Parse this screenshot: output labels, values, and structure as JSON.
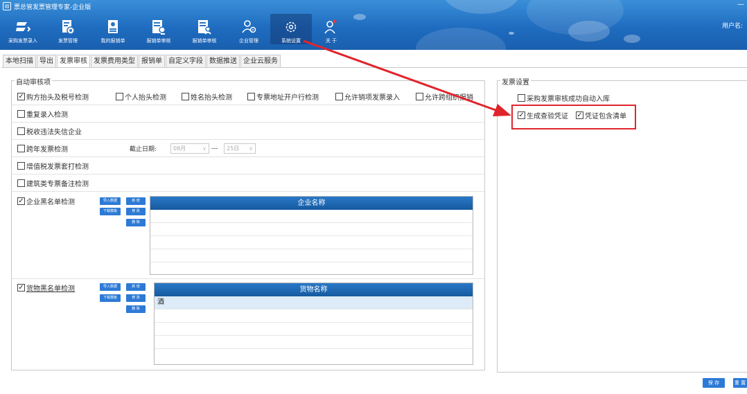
{
  "window": {
    "title": "票总管发票管理专家-企业版",
    "minimize_glyph": "—"
  },
  "toolbar": [
    {
      "label": "采购发票录入",
      "icon": "invoice-entry-icon"
    },
    {
      "label": "发票管理",
      "icon": "invoice-manage-icon"
    },
    {
      "label": "我的报销单",
      "icon": "my-reimburse-icon"
    },
    {
      "label": "报销单审核",
      "icon": "reimburse-review-icon"
    },
    {
      "label": "报销单审核",
      "icon": "reimburse-review-icon"
    },
    {
      "label": "企业管理",
      "icon": "enterprise-icon"
    },
    {
      "label": "系统设置",
      "icon": "gear-icon",
      "active": true
    },
    {
      "label": "关 于",
      "icon": "about-icon"
    }
  ],
  "user_label": "用户名:",
  "tabs": [
    "本地扫描",
    "导出",
    "发票审核",
    "发票费用类型",
    "报销单",
    "自定义字段",
    "数据推送",
    "企业云服务"
  ],
  "active_tab": "发票审核",
  "auto_review": {
    "legend": "自动审核项",
    "row1": [
      {
        "label": "购方抬头及税号检测",
        "checked": true
      },
      {
        "label": "个人抬头检测",
        "checked": false
      },
      {
        "label": "姓名抬头检测",
        "checked": false
      },
      {
        "label": "专票地址开户行检测",
        "checked": false
      },
      {
        "label": "允许销项发票录入",
        "checked": false
      },
      {
        "label": "允许跨组织报销",
        "checked": false
      }
    ],
    "dup_entry": {
      "label": "重复录入检测",
      "checked": false
    },
    "tax_violation": {
      "label": "税收违法失信企业",
      "checked": false
    },
    "cross_year": {
      "label": "跨年发票检测",
      "checked": false
    },
    "deadline_label": "截止日期:",
    "deadline_month": "08月",
    "deadline_sep": "---",
    "deadline_day": "25日",
    "vat_overprint": {
      "label": "增值税发票套打检测",
      "checked": false
    },
    "construction_note": {
      "label": "建筑类专票备注检测",
      "checked": false
    },
    "company_blacklist": {
      "label": "企业黑名单检测",
      "checked": true,
      "buttons": {
        "import": "导入数据",
        "template": "下载模板",
        "add": "新 增",
        "edit": "修 改",
        "delete": "删 除"
      },
      "column": "企业名称",
      "rows": []
    },
    "goods_blacklist": {
      "label": "货物黑名单检测",
      "checked": true,
      "buttons": {
        "import": "导入数据",
        "template": "下载模板",
        "add": "新 增",
        "edit": "修 改",
        "delete": "删 除"
      },
      "column": "货物名称",
      "rows": [
        "酒"
      ]
    }
  },
  "invoice_settings": {
    "legend": "发票设置",
    "auto_stock": {
      "label": "采购发票审核成功自动入库",
      "checked": false
    },
    "gen_voucher": {
      "label": "生成查验凭证",
      "checked": true
    },
    "voucher_list": {
      "label": "凭证包含清单",
      "checked": true
    }
  },
  "footer": {
    "save": "保 存",
    "reset": "重 置"
  },
  "colors": {
    "header": "#1f6cc0",
    "accent": "#2d7ad6",
    "highlight": "#e0242c"
  }
}
